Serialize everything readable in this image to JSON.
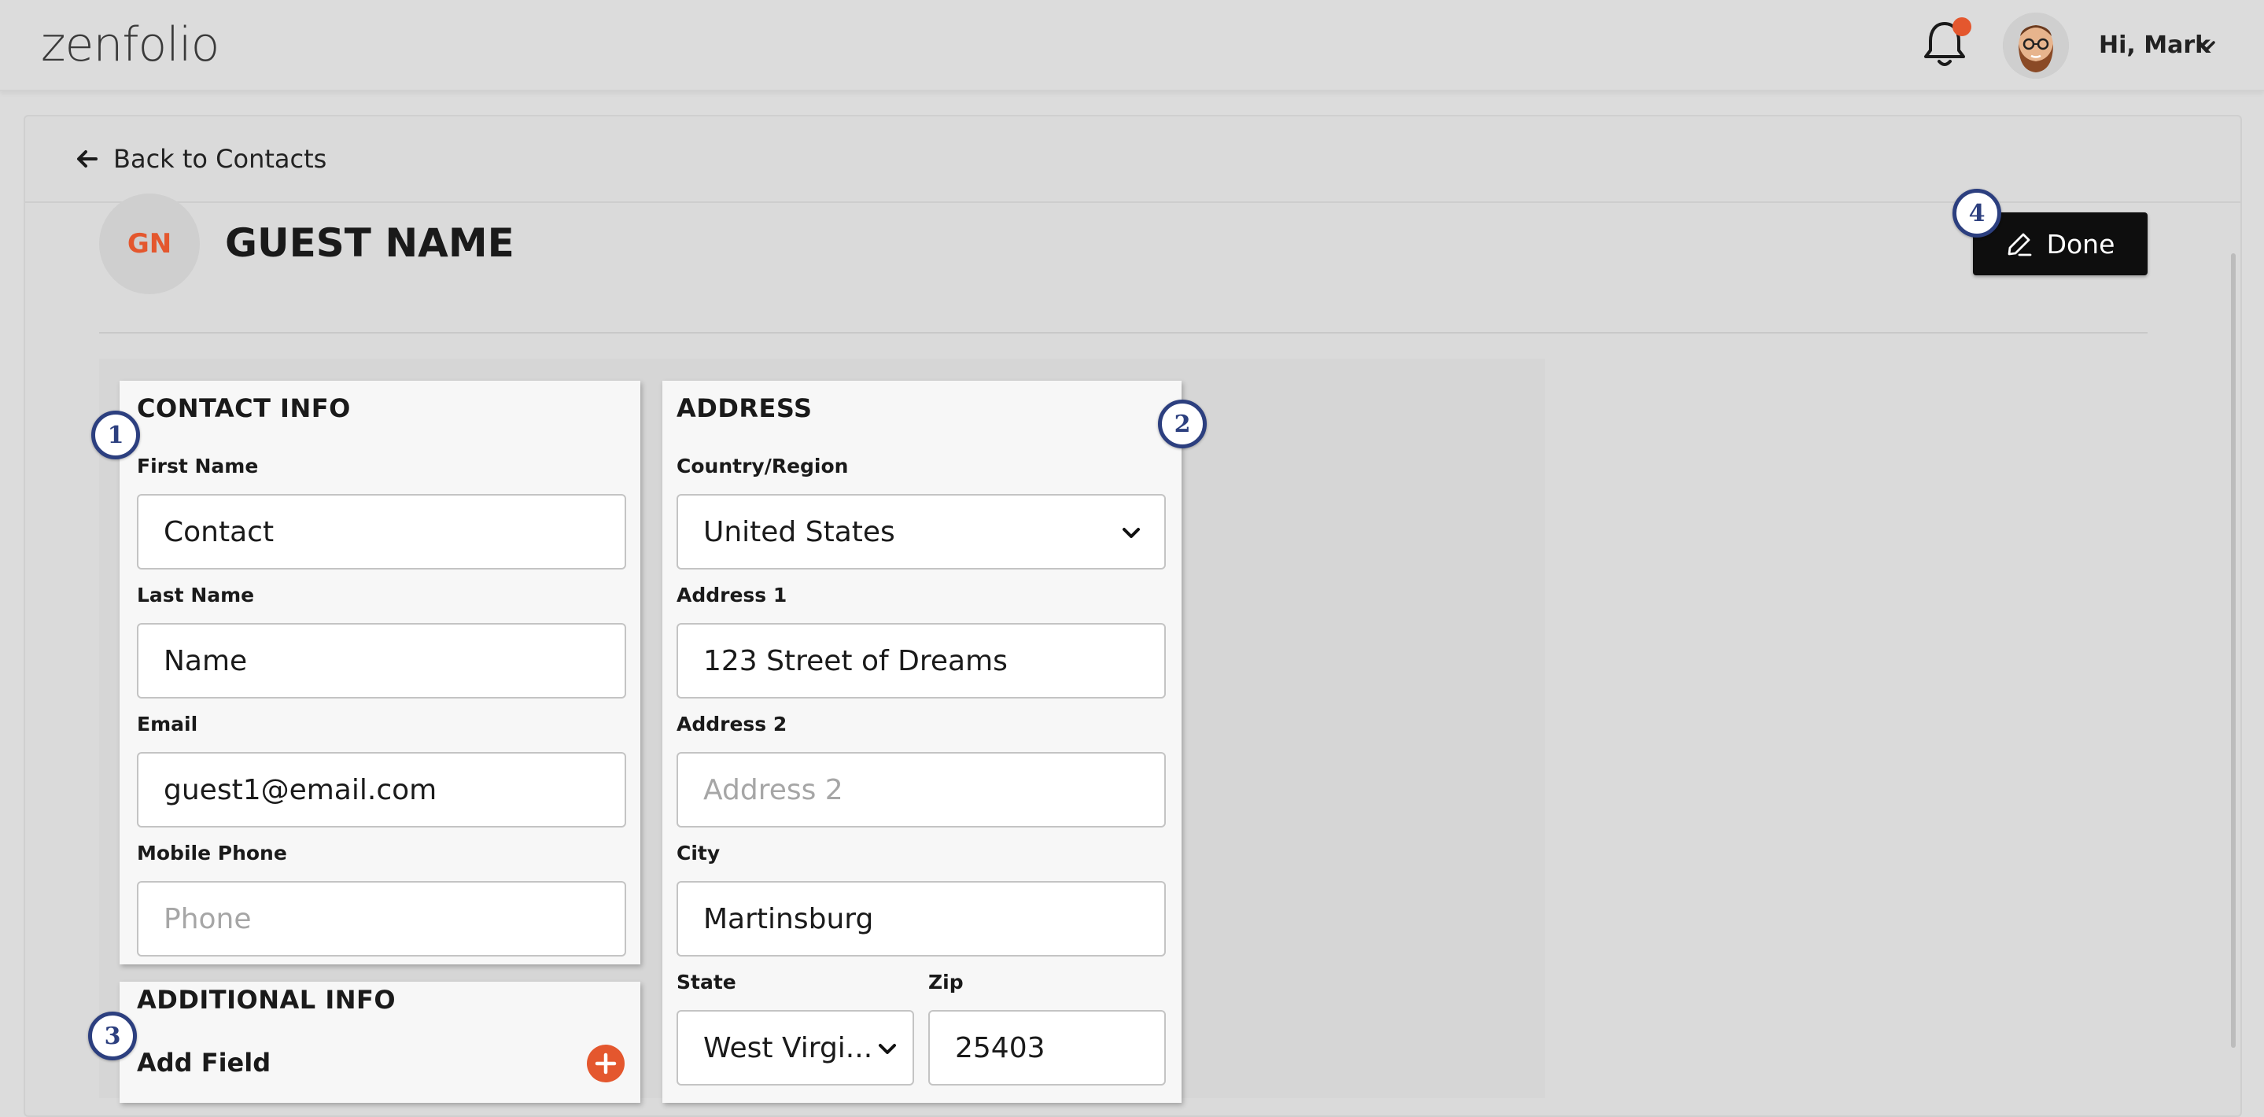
{
  "header": {
    "logo_text": "zenfolio",
    "greeting": "Hi, Mark",
    "notification_dot_color": "#e4572e"
  },
  "nav": {
    "back_label": "Back to Contacts"
  },
  "contact": {
    "initials": "GN",
    "name": "GUEST NAME",
    "done_label": "Done"
  },
  "contact_info": {
    "title": "CONTACT INFO",
    "first_name_label": "First Name",
    "first_name_value": "Contact",
    "last_name_label": "Last Name",
    "last_name_value": "Name",
    "email_label": "Email",
    "email_value": "guest1@email.com",
    "phone_label": "Mobile Phone",
    "phone_placeholder": "Phone"
  },
  "additional_info": {
    "title": "ADDITIONAL INFO",
    "add_field_label": "Add Field"
  },
  "address": {
    "title": "ADDRESS",
    "country_label": "Country/Region",
    "country_value": "United States",
    "address1_label": "Address 1",
    "address1_value": "123 Street of Dreams",
    "address2_label": "Address 2",
    "address2_placeholder": "Address 2",
    "city_label": "City",
    "city_value": "Martinsburg",
    "state_label": "State",
    "state_value": "West Virgi...",
    "zip_label": "Zip",
    "zip_value": "25403"
  },
  "badges": {
    "one": "1",
    "two": "2",
    "three": "3",
    "four": "4"
  },
  "colors": {
    "accent": "#e4572e",
    "badge": "#2c3f7f",
    "done_button": "#0e0e0e"
  }
}
